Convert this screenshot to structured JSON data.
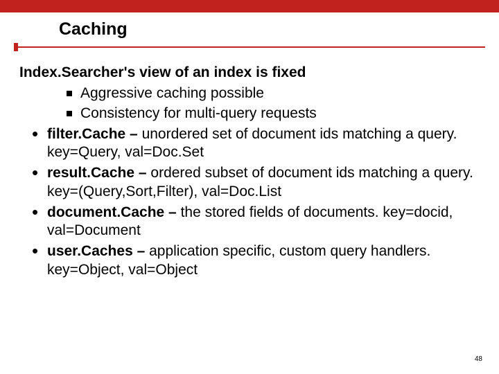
{
  "title": "Caching",
  "heading": "Index.Searcher's view of an index is fixed",
  "sub_items": [
    "Aggressive caching possible",
    "Consistency for multi-query requests"
  ],
  "bullets": [
    {
      "bold": "filter.Cache – ",
      "rest": "unordered set of document ids matching a query. key=Query, val=Doc.Set"
    },
    {
      "bold": "result.Cache – ",
      "rest": "ordered subset of document ids matching a query. key=(Query,Sort,Filter), val=Doc.List"
    },
    {
      "bold": "document.Cache – ",
      "rest": "the stored fields of documents. key=docid, val=Document"
    },
    {
      "bold": "user.Caches – ",
      "rest": "application specific, custom query handlers. key=Object, val=Object"
    }
  ],
  "page_number": "48"
}
